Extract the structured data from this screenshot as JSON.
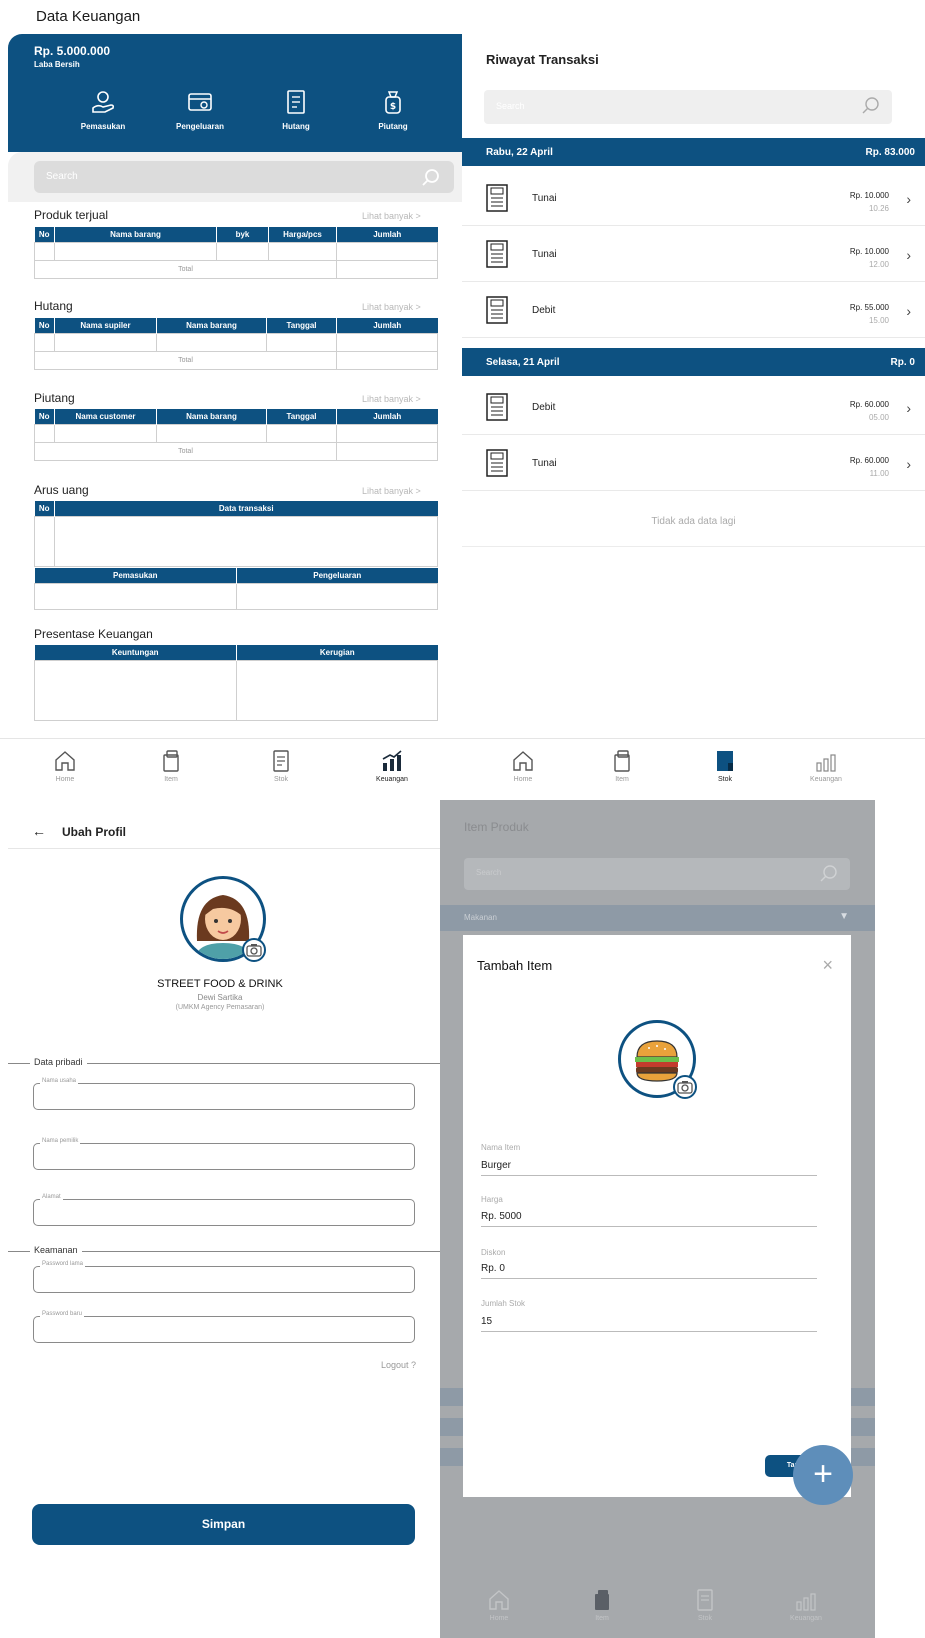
{
  "finance": {
    "title": "Data Keuangan",
    "amount": "Rp. 5.000.000",
    "amount_label": "Laba Bersih",
    "actions": [
      "Pemasukan",
      "Pengeluaran",
      "Hutang",
      "Piutang"
    ],
    "search_placeholder": "Search",
    "see_more": "Lihat banyak  >",
    "produk": {
      "title": "Produk terjual",
      "cols": [
        "No",
        "Nama barang",
        "byk",
        "Harga/pcs",
        "Jumlah"
      ],
      "total": "Total"
    },
    "hutang": {
      "title": "Hutang",
      "cols": [
        "No",
        "Nama supiler",
        "Nama barang",
        "Tanggal",
        "Jumlah"
      ],
      "total": "Total"
    },
    "piutang": {
      "title": "Piutang",
      "cols": [
        "No",
        "Nama customer",
        "Nama barang",
        "Tanggal",
        "Jumlah"
      ],
      "total": "Total"
    },
    "arus": {
      "title": "Arus uang",
      "cols": [
        "No",
        "Data transaksi"
      ],
      "sub_cols": [
        "Pemasukan",
        "Pengeluaran"
      ]
    },
    "presentase": {
      "title": "Presentase Keuangan",
      "cols": [
        "Keuntungan",
        "Kerugian"
      ]
    }
  },
  "nav": {
    "items": [
      "Home",
      "Item",
      "Stok",
      "Keuangan"
    ]
  },
  "history": {
    "title": "Riwayat Transaksi",
    "search_placeholder": "Search",
    "days": [
      {
        "date": "Rabu, 22 April",
        "total": "Rp. 83.000",
        "rows": [
          {
            "label": "Tunai",
            "amount": "Rp. 10.000",
            "time": "10.26"
          },
          {
            "label": "Tunai",
            "amount": "Rp. 10.000",
            "time": "12.00"
          },
          {
            "label": "Debit",
            "amount": "Rp. 55.000",
            "time": "15.00"
          }
        ]
      },
      {
        "date": "Selasa, 21 April",
        "total": "Rp. 0",
        "rows": [
          {
            "label": "Debit",
            "amount": "Rp. 60.000",
            "time": "05.00"
          },
          {
            "label": "Tunai",
            "amount": "Rp. 60.000",
            "time": "11.00"
          }
        ]
      }
    ],
    "empty": "Tidak ada data lagi"
  },
  "profile": {
    "title": "Ubah Profil",
    "shop": "STREET FOOD & DRINK",
    "owner": "Dewi Sartika",
    "role": "(UMKM Agency Pemasaran)",
    "personal_group": "Data pribadi",
    "fields_personal": [
      "Nama usaha",
      "Nama pemilik",
      "Alamat"
    ],
    "security_group": "Keamanan",
    "fields_security": [
      "Password lama",
      "Password baru"
    ],
    "logout": "Logout ?",
    "save": "Simpan"
  },
  "item": {
    "title": "Item Produk",
    "search_placeholder": "Search",
    "category": "Makanan",
    "category_arrow": "▼",
    "modal": {
      "title": "Tambah Item",
      "close": "×",
      "fields": [
        {
          "label": "Nama Item",
          "value": "Burger"
        },
        {
          "label": "Harga",
          "value": "Rp. 5000"
        },
        {
          "label": "Diskon",
          "value": "Rp. 0"
        },
        {
          "label": "Jumlah Stok",
          "value": "15"
        }
      ],
      "submit": "Tambah"
    },
    "fab": "+"
  },
  "colors": {
    "primary": "#0d5181",
    "overlay": "#a6a9ac",
    "fab": "#5e8eba"
  }
}
